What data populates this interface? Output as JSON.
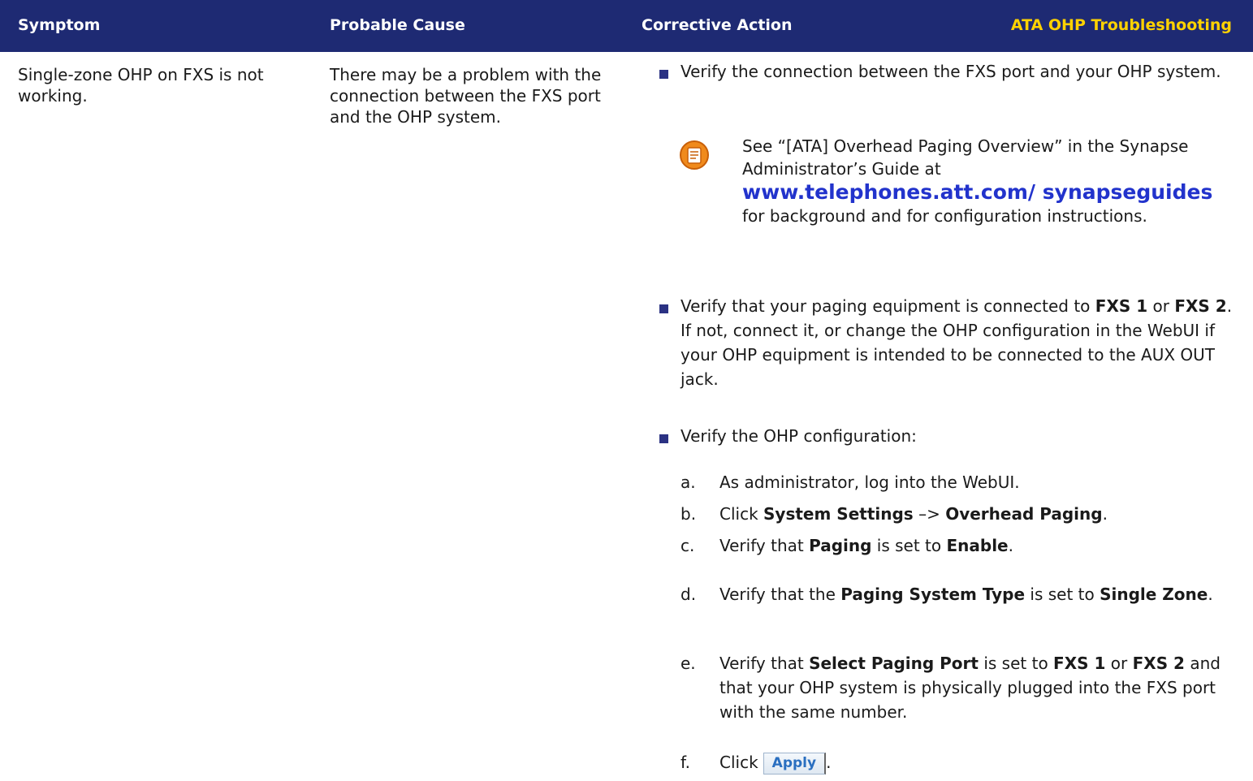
{
  "header": {
    "symptom": "Symptom",
    "probable_cause": "Probable Cause",
    "corrective_action": "Corrective Action",
    "section_title": "ATA OHP Troubleshooting"
  },
  "row": {
    "symptom": "Single-zone OHP on FXS is not working.",
    "probable_cause": "There may be a problem with the connection between the FXS port and the OHP system."
  },
  "actions": {
    "bullet1": "Verify the connection between the FXS port and your OHP system.",
    "note": {
      "before": "See “[ATA] Overhead Paging Overview” in the Synapse Administrator’s Guide at",
      "link": "www.telephones.att.com/ synapseguides",
      "after": "for background and for configuration instructions."
    },
    "bullet2": {
      "t1": "Verify that your paging equipment is connected to",
      "fxs1": "FXS 1",
      "t2": "or",
      "fxs2": "FXS 2",
      "t3": ". If not, connect it, or change the OHP configuration in the WebUI if your OHP equipment is intended to be connected to the AUX OUT jack."
    },
    "bullet3": "Verify the OHP configuration:",
    "steps": {
      "a": {
        "letter": "a.",
        "text": "As administrator, log into the WebUI."
      },
      "b": {
        "letter": "b.",
        "t1": "Click",
        "b1": "System Settings",
        "t2": "–>",
        "b2": "Overhead Paging",
        "t3": "."
      },
      "c": {
        "letter": "c.",
        "t1": "Verify that",
        "b1": "Paging",
        "t2": "is set to",
        "b2": "Enable",
        "t3": "."
      },
      "d": {
        "letter": "d.",
        "t1": "Verify that the",
        "b1": "Paging System Type",
        "t2": "is set to",
        "b2": "Single Zone",
        "t3": "."
      },
      "e": {
        "letter": "e.",
        "t1": "Verify that",
        "b1": "Select Paging Port",
        "t2": "is set to",
        "b2": "FXS 1",
        "t3": "or",
        "b3": "FXS 2",
        "t4": "and that your OHP system is physically plugged into the FXS port with the same number."
      },
      "f": {
        "letter": "f.",
        "t1": "Click",
        "button": "Apply",
        "t2": "."
      }
    }
  },
  "colors": {
    "header_bg": "#1e2a73",
    "section_title": "#ffd200",
    "link": "#2233cc",
    "bullet": "#2b3283"
  },
  "icons": {
    "note": "note-icon"
  }
}
